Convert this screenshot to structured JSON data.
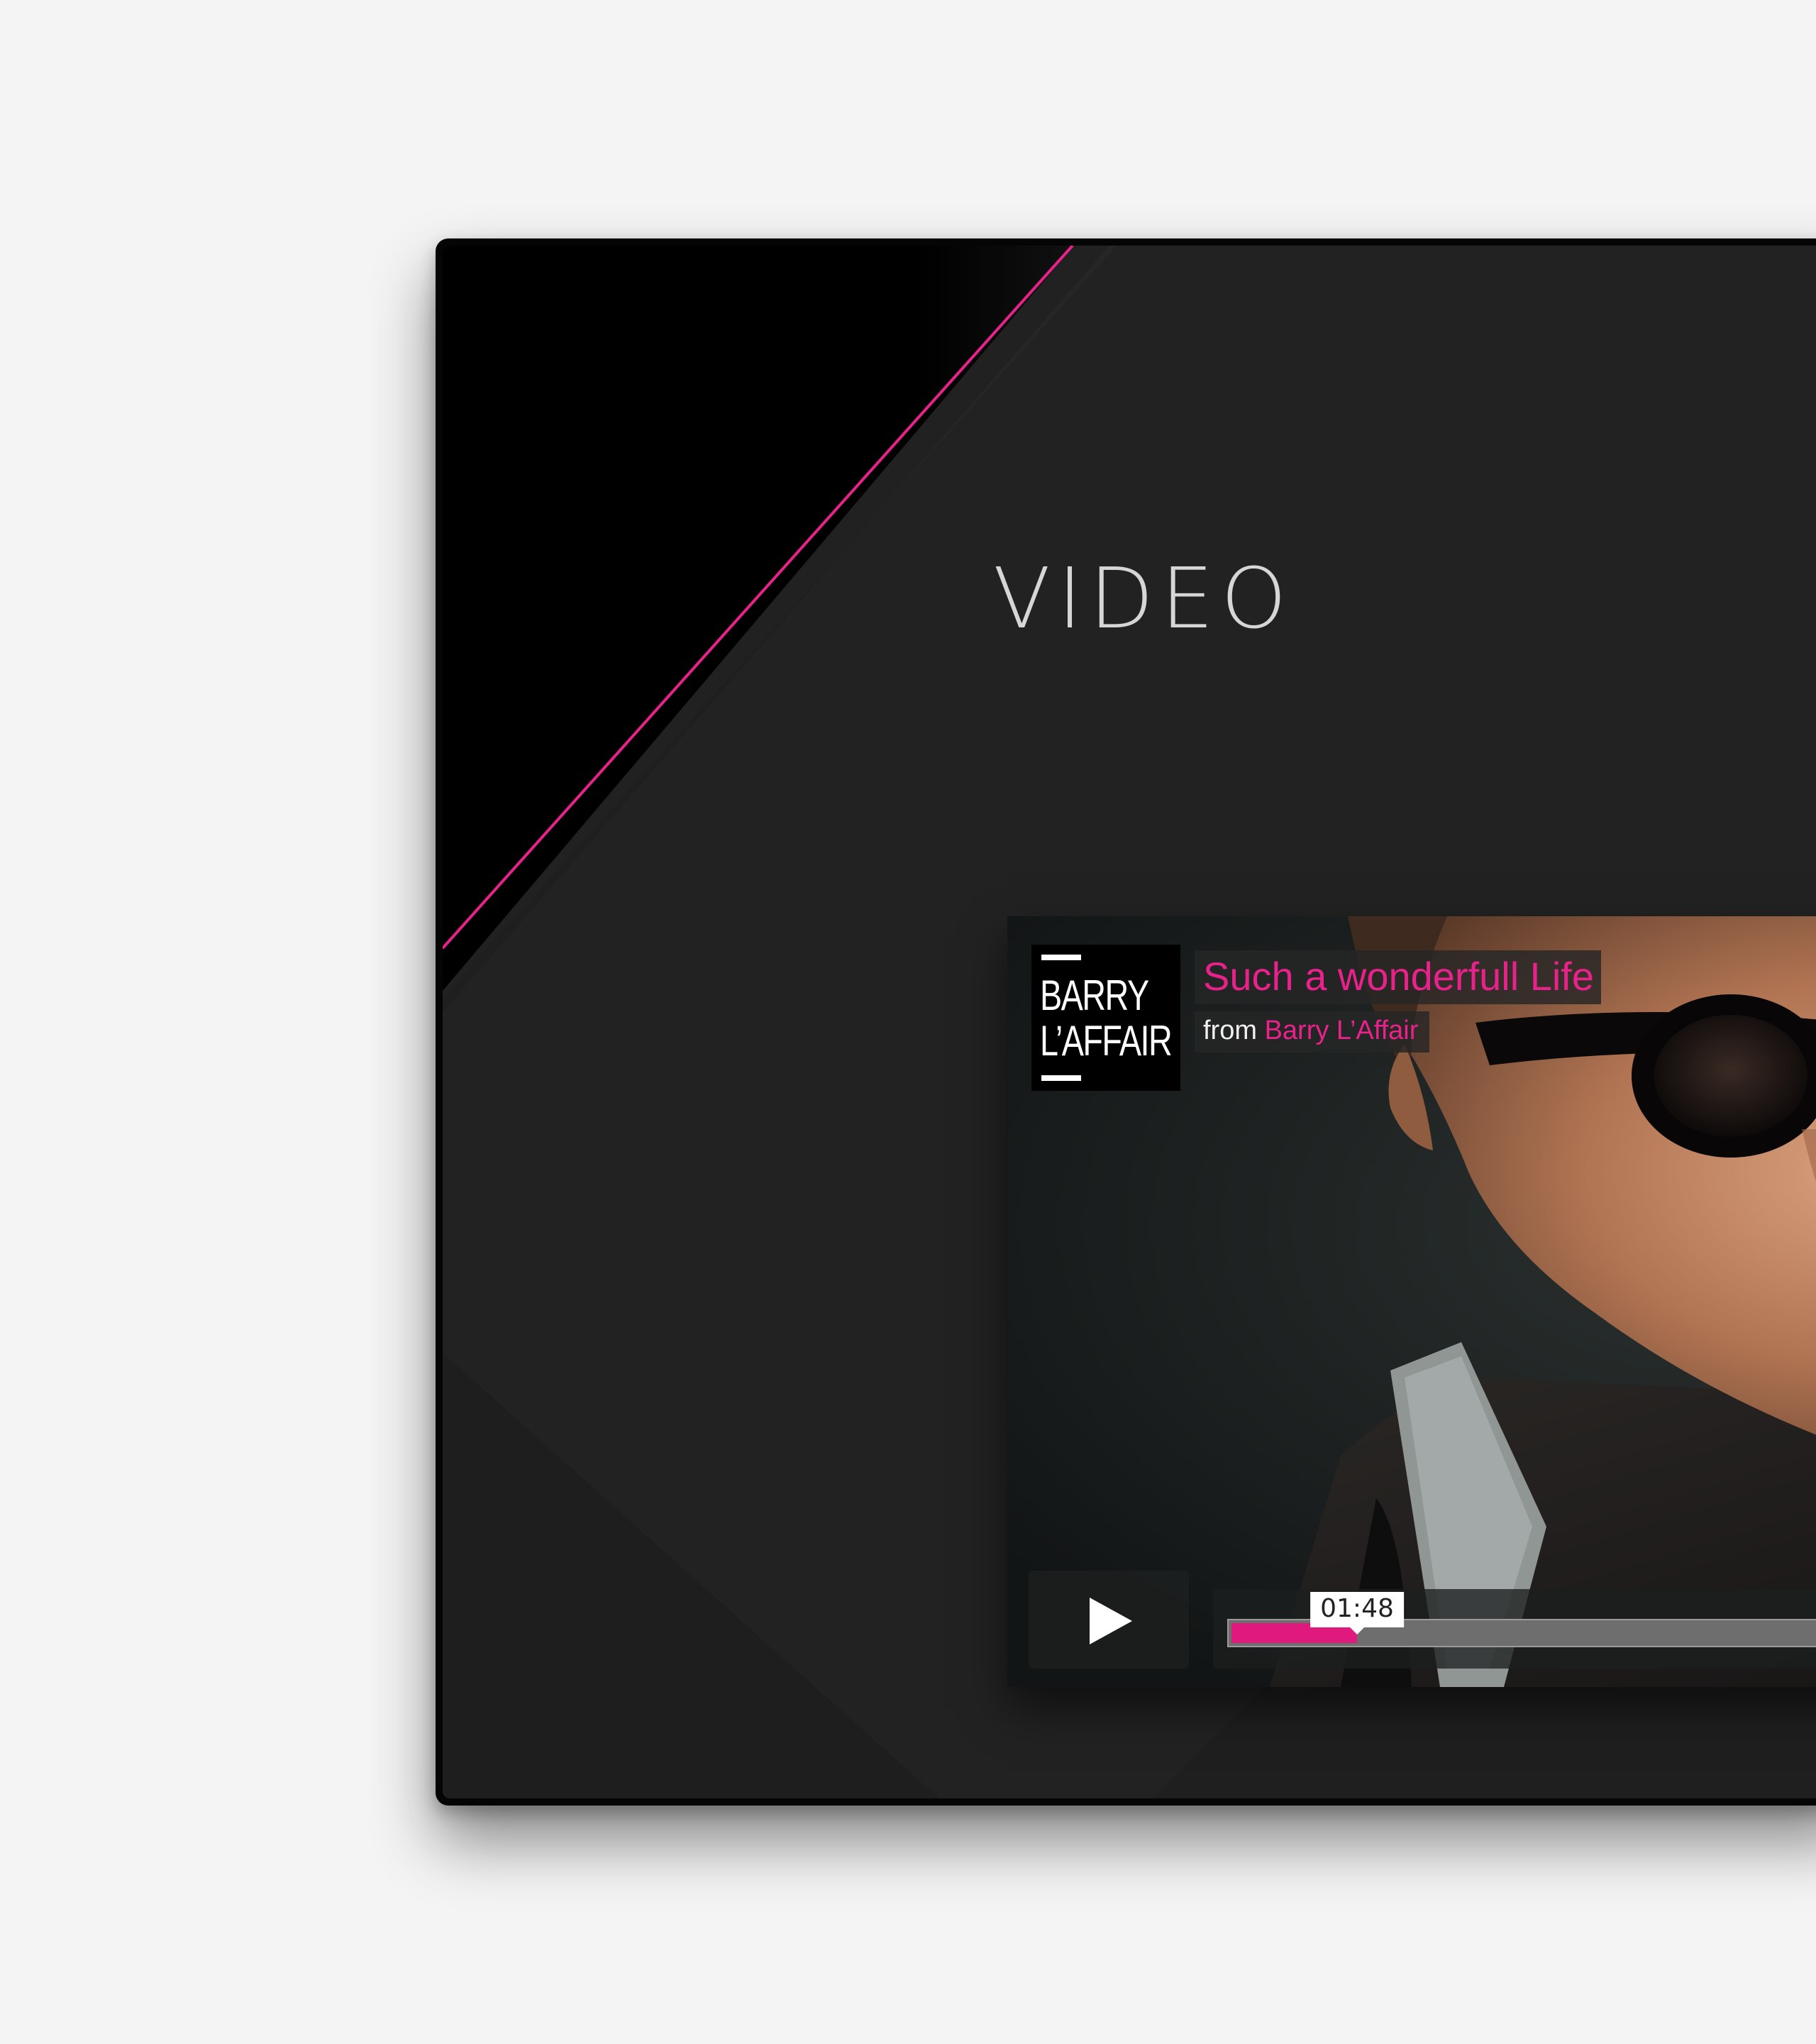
{
  "section": {
    "title": "VIDEO"
  },
  "video": {
    "title": "Such a wonderfull Life",
    "byline_prefix": "from",
    "artist": "Barry L’Affair",
    "brand_line1": "BARRY",
    "brand_line2": "L’AFFAIR",
    "current_time": "01:48",
    "progress": 0.12
  },
  "colors": {
    "accent": "#e8228a",
    "background": "#222222",
    "page": "#f4f4f4"
  },
  "icons": {
    "play": "play-icon"
  }
}
